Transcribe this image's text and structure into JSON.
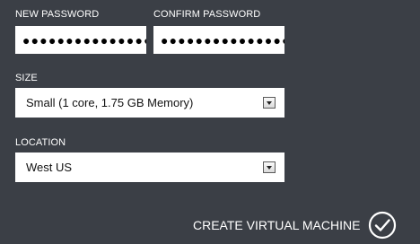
{
  "form": {
    "new_password": {
      "label": "NEW PASSWORD",
      "value": "●●●●●●●●●●●●●●●●"
    },
    "confirm_password": {
      "label": "CONFIRM PASSWORD",
      "value": "●●●●●●●●●●●●●●●●"
    },
    "size": {
      "label": "SIZE",
      "selected": "Small (1 core, 1.75 GB Memory)"
    },
    "location": {
      "label": "LOCATION",
      "selected": "West US"
    }
  },
  "actions": {
    "create_label": "CREATE VIRTUAL MACHINE",
    "create_icon": "check-circle-icon"
  },
  "colors": {
    "background": "#3b3f46",
    "field_background": "#ffffff",
    "text": "#ffffff"
  }
}
